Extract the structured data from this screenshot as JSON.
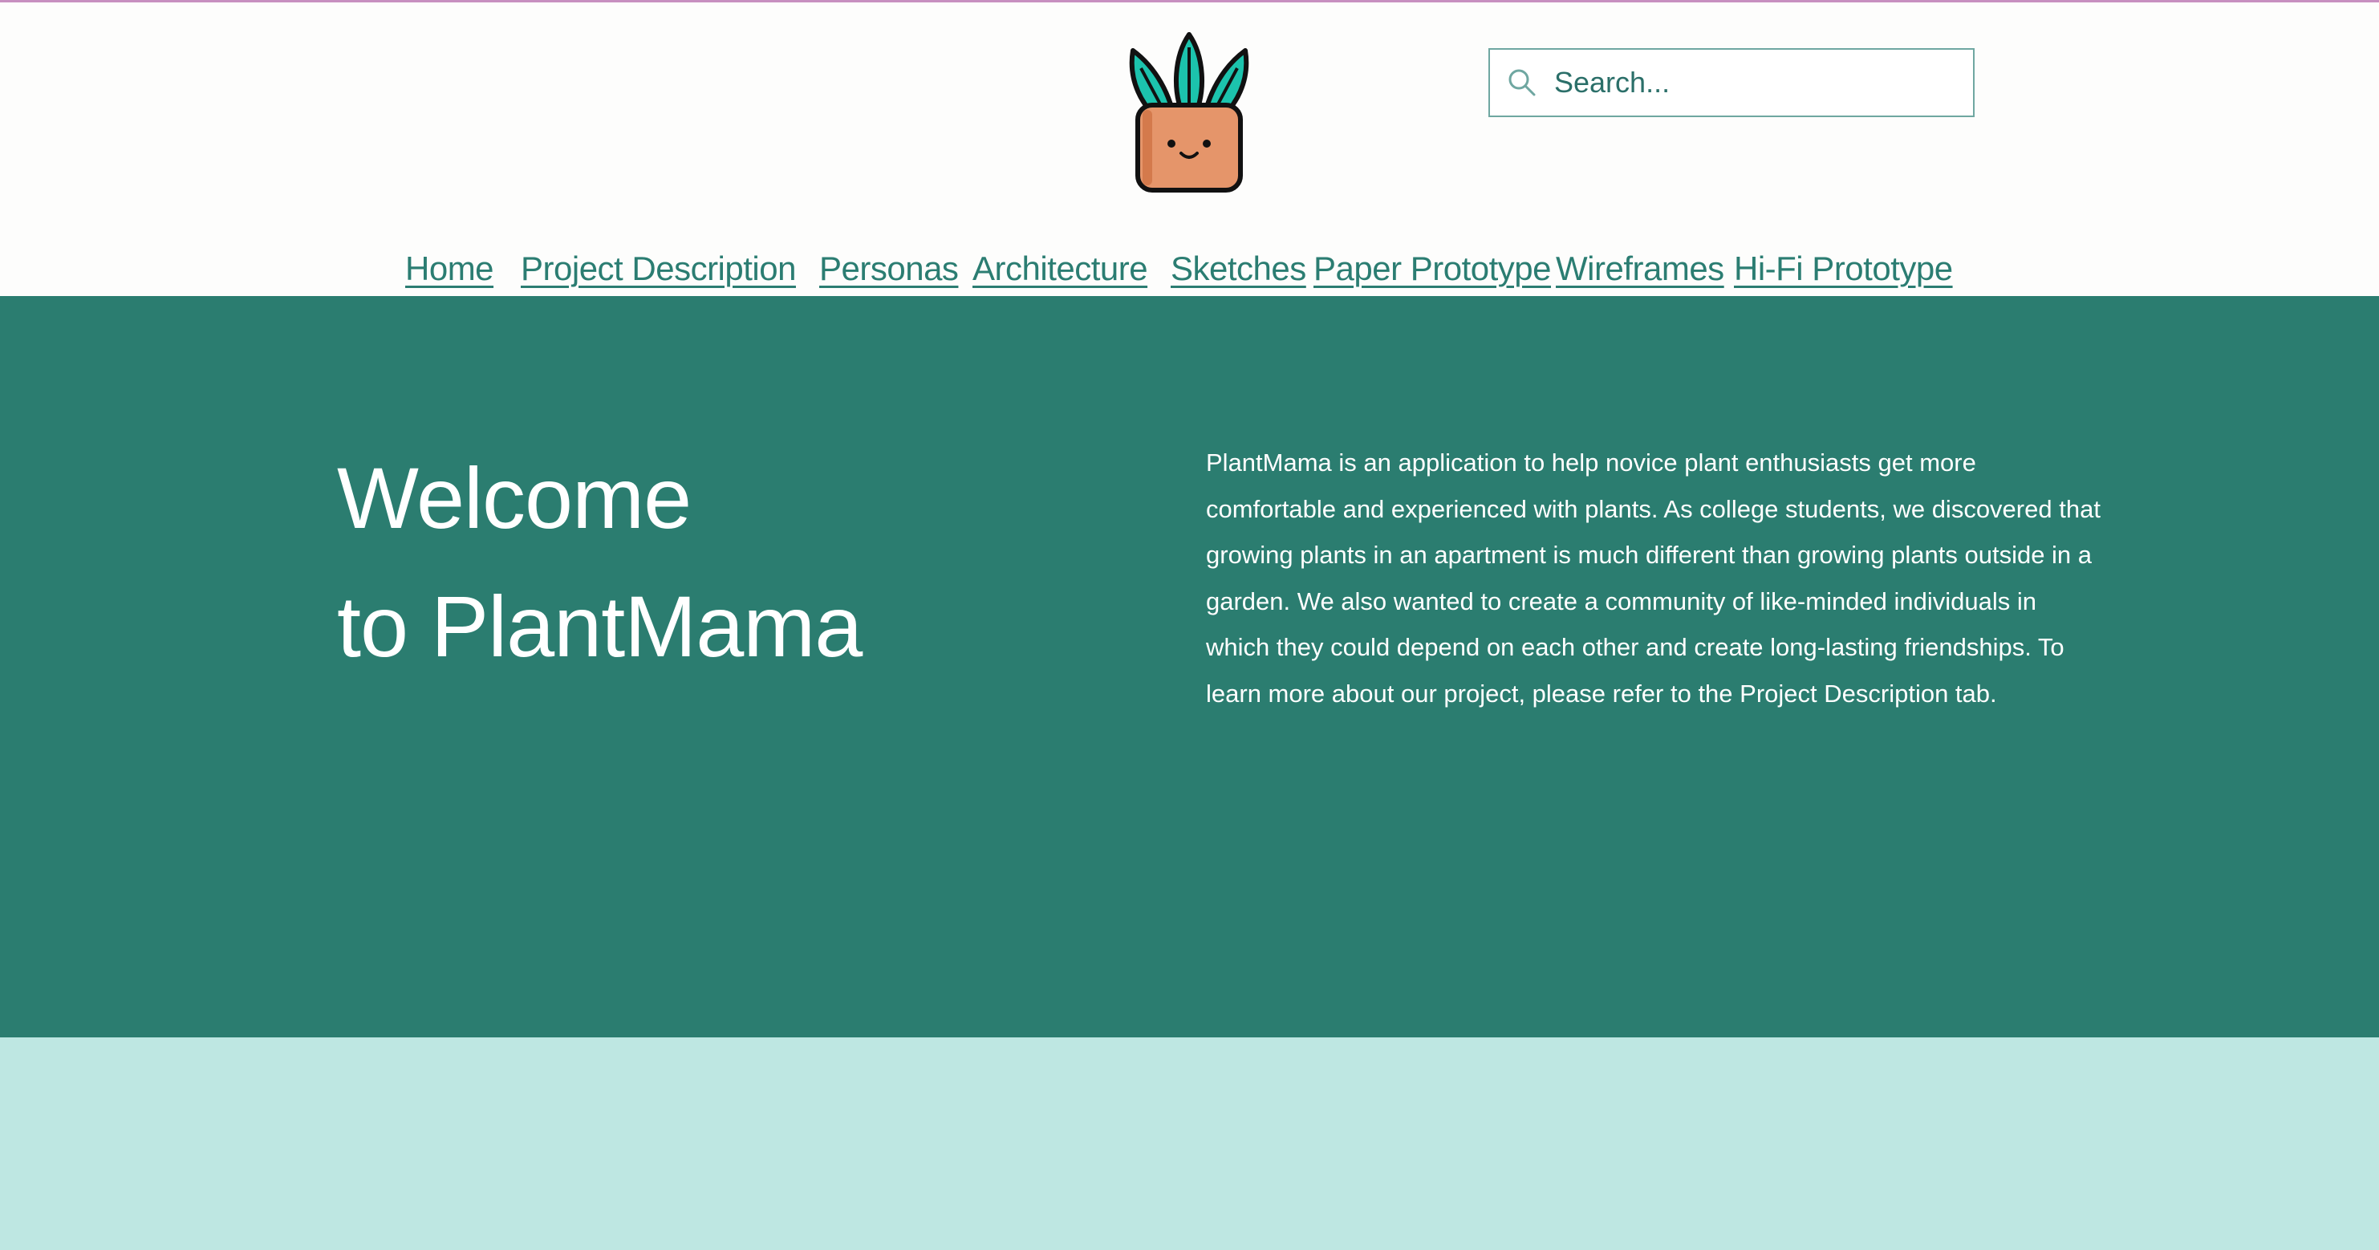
{
  "header": {
    "logo_icon": "potted-plant-icon",
    "search": {
      "icon": "search-icon",
      "placeholder": "Search..."
    }
  },
  "nav": {
    "items": [
      {
        "label": "Home"
      },
      {
        "label": "Project Description"
      },
      {
        "label": "Personas"
      },
      {
        "label": "Architecture"
      },
      {
        "label": "Sketches"
      },
      {
        "label": "Paper Prototype"
      },
      {
        "label": "Wireframes"
      },
      {
        "label": "Hi-Fi Prototype"
      }
    ]
  },
  "hero": {
    "title_line1": "Welcome",
    "title_line2": "to PlantMama",
    "description": "PlantMama is an application to help novice plant enthusiasts get more comfortable and experienced with plants. As college students, we discovered that growing plants in an apartment is much different than growing plants outside in a garden. We also wanted to create a community of like-minded individuals in which they could depend on each other and create long-lasting friendships. To learn more about our project, please refer to the Project Description tab."
  },
  "colors": {
    "hero_background": "#2b7d70",
    "lower_background": "#bee7e2",
    "nav_link": "#2b7d72",
    "top_border": "#c78fc0"
  }
}
